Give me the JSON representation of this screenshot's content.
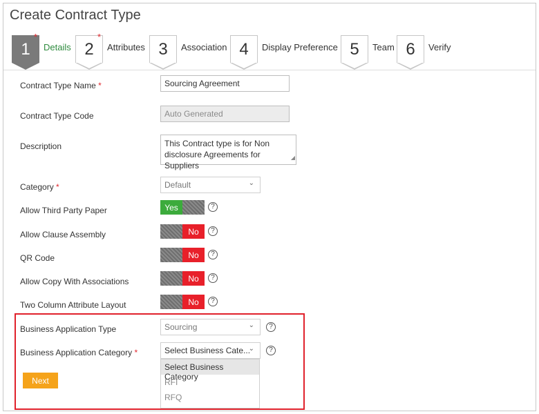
{
  "page": {
    "title": "Create Contract Type"
  },
  "steps": [
    {
      "number": "1",
      "label": "Details",
      "required": "*"
    },
    {
      "number": "2",
      "label": "Attributes",
      "required": "*"
    },
    {
      "number": "3",
      "label": "Association"
    },
    {
      "number": "4",
      "label": "Display Preference"
    },
    {
      "number": "5",
      "label": "Team"
    },
    {
      "number": "6",
      "label": "Verify"
    }
  ],
  "form": {
    "name": {
      "label": "Contract Type Name",
      "required": "*",
      "value": "Sourcing Agreement"
    },
    "code": {
      "label": "Contract Type Code",
      "value": "Auto Generated"
    },
    "description": {
      "label": "Description",
      "line1": "This Contract type is for Non",
      "line2": "disclosure Agreements for Suppliers"
    },
    "category": {
      "label": "Category",
      "required": "*",
      "value": "Default"
    },
    "third_party": {
      "label": "Allow Third Party Paper",
      "value": "Yes"
    },
    "clause_assembly": {
      "label": "Allow Clause Assembly",
      "value": "No"
    },
    "qr_code": {
      "label": "QR Code",
      "value": "No"
    },
    "copy_assoc": {
      "label": "Allow Copy With Associations",
      "value": "No"
    },
    "two_column": {
      "label": "Two Column Attribute Layout",
      "value": "No"
    },
    "biz_type": {
      "label": "Business Application Type",
      "value": "Sourcing"
    },
    "biz_category": {
      "label": "Business Application Category",
      "required": "*",
      "value": "Select Business Cate...",
      "options": [
        "Select Business Category",
        "RFI",
        "RFQ"
      ]
    },
    "help_glyph": "?",
    "chevron": "⌄"
  },
  "actions": {
    "next_label": "Next"
  },
  "colors": {
    "accent_green": "#3cab3c",
    "off_red": "#e8202a",
    "button_orange": "#f5a31a",
    "highlight_red": "#e0202a"
  }
}
